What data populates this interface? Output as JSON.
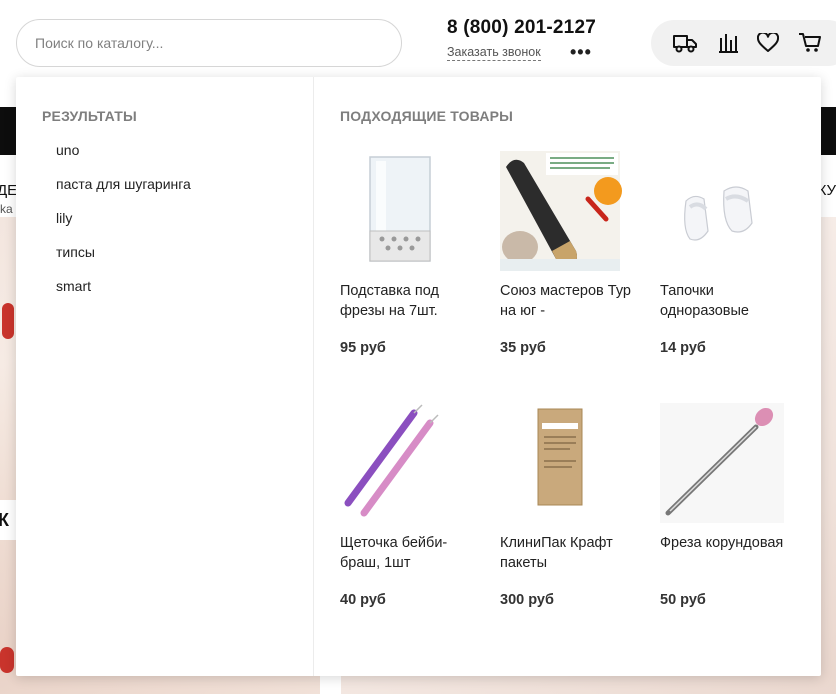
{
  "header": {
    "search_placeholder": "Поиск по каталогу...",
    "phone": "8 (800) 201-2127",
    "callback_label": "Заказать звонок",
    "more_label": "•••",
    "icons": [
      "truck-icon",
      "compare-icon",
      "heart-icon",
      "cart-icon"
    ]
  },
  "background": {
    "nav_left_line1": "ДЕ",
    "nav_left_line2": "ka",
    "nav_right_line1": "КУ",
    "left_banner_text": "К"
  },
  "dropdown": {
    "results_title": "РЕЗУЛЬТАТЫ",
    "results": [
      "uno",
      "паста для шугаринга",
      "lily",
      "типсы",
      "smart"
    ],
    "products_title": "ПОДХОДЯЩИЕ ТОВАРЫ",
    "products": [
      {
        "name": "Подставка под фрезы на 7шт.",
        "price": "95 руб",
        "image": "burr-stand"
      },
      {
        "name": "Союз мастеров Тур на юг -",
        "price": "35 руб",
        "image": "pedicure-file"
      },
      {
        "name": "Тапочки одноразовые",
        "price": "14 руб",
        "image": "disposable-slippers"
      },
      {
        "name": "Щеточка бейби-браш, 1шт",
        "price": "40 руб",
        "image": "baby-brush"
      },
      {
        "name": "КлиниПак Крафт пакеты",
        "price": "300 руб",
        "image": "kraft-pouch"
      },
      {
        "name": "Фреза корундовая",
        "price": "50 руб",
        "image": "corundum-burr"
      }
    ]
  },
  "colors": {
    "accent_dark": "#0d0d0d",
    "icon_bar_bg": "#f1f1f1",
    "section_title": "#7e7e7e"
  }
}
